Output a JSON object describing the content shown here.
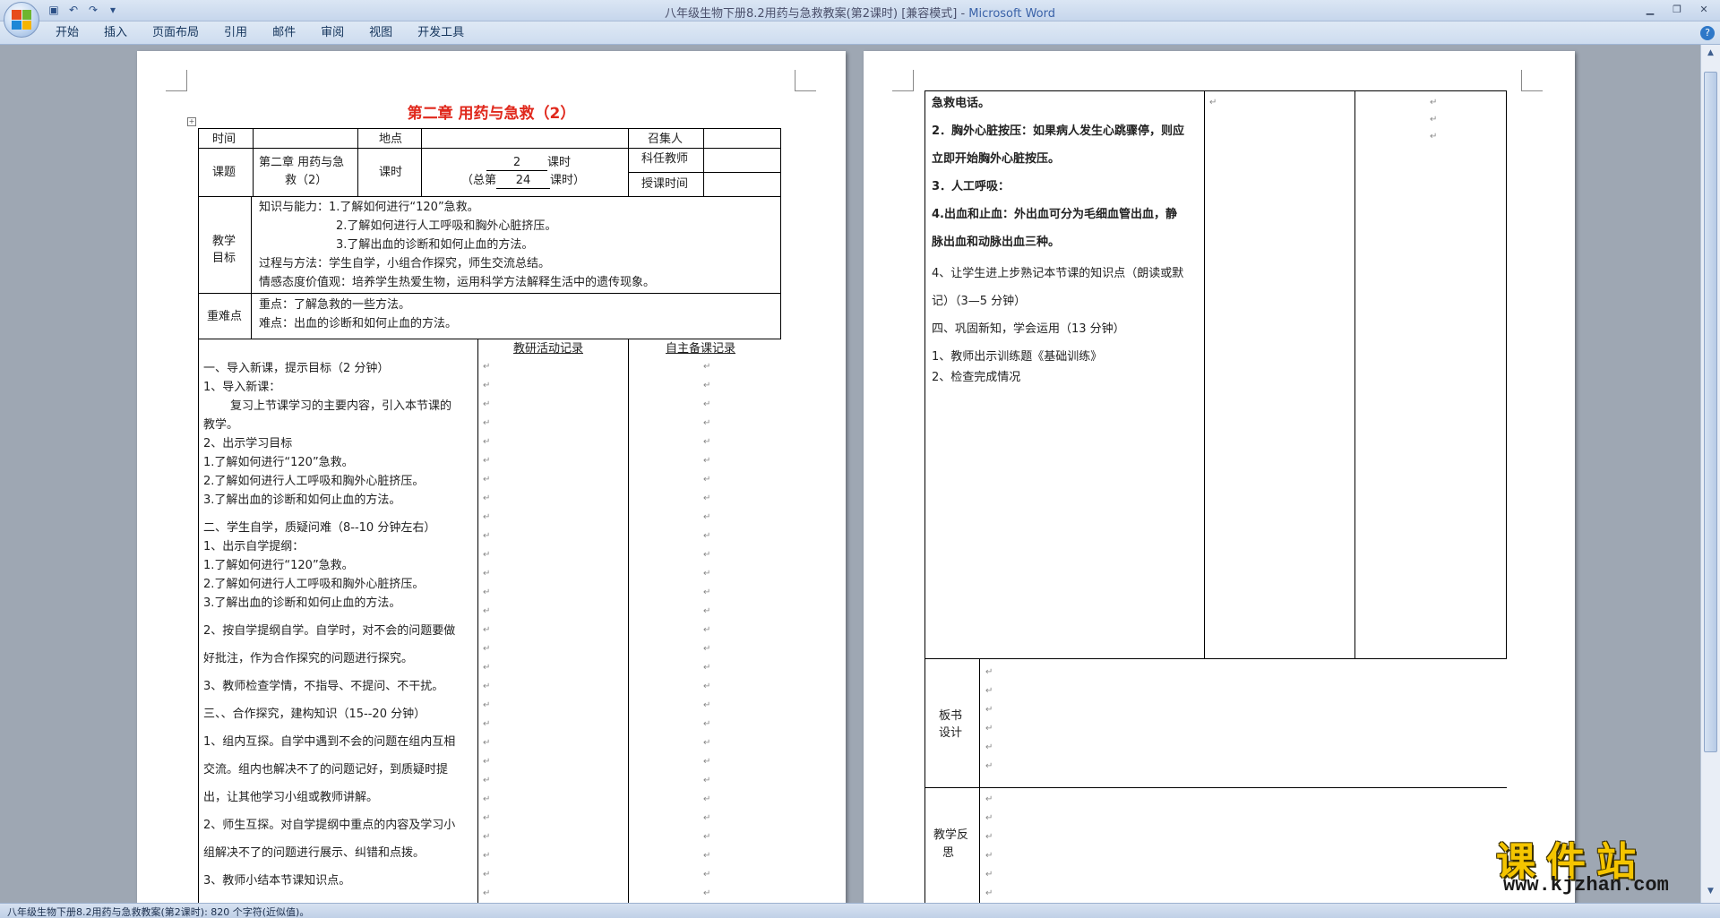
{
  "window": {
    "title": "八年级生物下册8.2用药与急救教案(第2课时) [兼容模式] - ",
    "app_name": "Microsoft Word",
    "qat_icons": [
      "save-icon",
      "undo-icon",
      "redo-icon",
      "customize-icon"
    ]
  },
  "menu": {
    "tabs": [
      "开始",
      "插入",
      "页面布局",
      "引用",
      "邮件",
      "审阅",
      "视图",
      "开发工具"
    ],
    "help": "?"
  },
  "page1": {
    "title": "第二章  用药与急救（2）",
    "header": {
      "time_label": "时间",
      "place_label": "地点",
      "convener_label": "召集人",
      "topic_label": "课题",
      "topic_value": [
        "第二章  用药与急",
        "救（2）"
      ],
      "hours_label": "课时",
      "hours_line1_num": "2",
      "hours_line1_suffix": "课时",
      "hours_line2_prefix": "（总第",
      "hours_line2_num": "24",
      "hours_line2_suffix": "课时）",
      "teacher_label": "科任教师",
      "lesson_time_label": "授课时间"
    },
    "goals": {
      "label": [
        "教学",
        "目标"
      ],
      "lines": [
        "知识与能力：1.了解如何进行“120”急救。",
        "2.了解如何进行人工呼吸和胸外心脏挤压。",
        "3.了解出血的诊断和如何止血的方法。",
        "过程与方法：学生自学，小组合作探究，师生交流总结。",
        "情感态度价值观：培养学生热爱生物，运用科学方法解释生活中的遗传现象。"
      ]
    },
    "key_points": {
      "label": "重难点",
      "lines": [
        "重点：了解急救的一些方法。",
        "难点：出血的诊断和如何止血的方法。"
      ]
    },
    "columns": {
      "research": "教研活动记录",
      "self_prep": "自主备课记录"
    },
    "body_lines": [
      "一、导入新课，提示目标（2 分钟）",
      "1、导入新课：",
      "复习上节课学习的主要内容，引入本节课的",
      "教学。",
      "2、出示学习目标",
      "1.了解如何进行“120”急救。",
      "2.了解如何进行人工呼吸和胸外心脏挤压。",
      "3.了解出血的诊断和如何止血的方法。",
      "二、学生自学，质疑问难（8--10 分钟左右）",
      "1、出示自学提纲：",
      "1.了解如何进行“120”急救。",
      "2.了解如何进行人工呼吸和胸外心脏挤压。",
      "3.了解出血的诊断和如何止血的方法。",
      "2、按自学提纲自学。自学时，对不会的问题要做",
      "好批注，作为合作探究的问题进行探究。",
      "3、教师检查学情，不指导、不提问、不干扰。",
      "三、、合作探究，建构知识（15--20 分钟）",
      "1、组内互探。自学中遇到不会的问题在组内互相",
      "交流。组内也解决不了的问题记好，到质疑时提",
      "出，让其他学习小组或教师讲解。",
      "2、师生互探。对自学提纲中重点的内容及学习小",
      "组解决不了的问题进行展示、纠错和点拨。",
      "3、教师小结本节课知识点。"
    ]
  },
  "page2": {
    "body_lines": [
      "急救电话。",
      "2．胸外心脏按压：如果病人发生心跳骤停，则应",
      "立即开始胸外心脏按压。",
      "3．人工呼吸：",
      "4.出血和止血：外出血可分为毛细血管出血，静",
      "脉出血和动脉出血三种。",
      "4、让学生进上步熟记本节课的知识点（朗读或默",
      "记）（3—5 分钟）",
      "四、巩固新知，学会运用（13 分钟）",
      "1、教师出示训练题《基础训练》",
      "2、检查完成情况"
    ],
    "board_label": [
      "板书",
      "设计"
    ],
    "reflection_label": [
      "教学反",
      "思"
    ]
  },
  "status": {
    "text": "八年级生物下册8.2用药与急救教案(第2课时): 820 个字符(近似值)。"
  },
  "watermark": {
    "brand": "课件站",
    "url": "www.kjzhan.com"
  },
  "marks": {
    "paragraph": "↵"
  }
}
